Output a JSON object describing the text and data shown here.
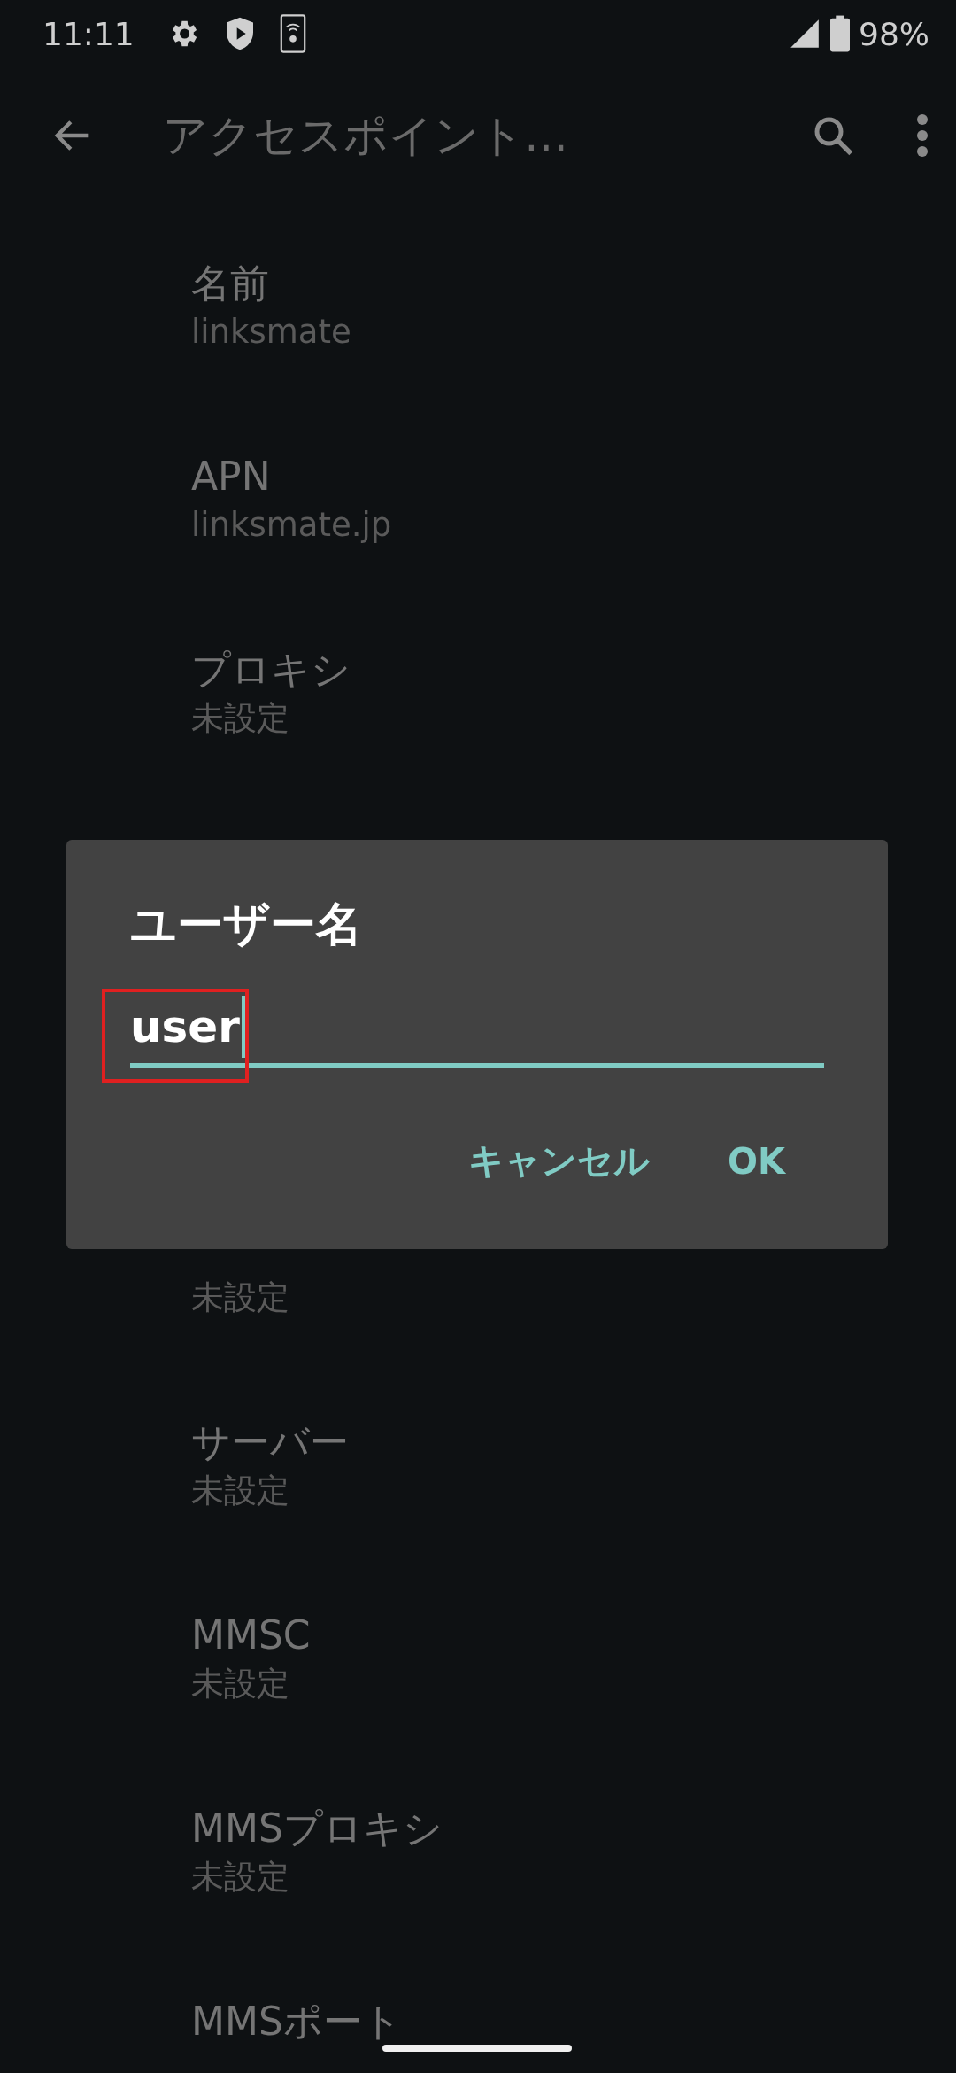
{
  "status_bar": {
    "time": "11:11",
    "battery": "98%"
  },
  "toolbar": {
    "title": "アクセスポイント…"
  },
  "settings_above": [
    {
      "title": "名前",
      "value": "linksmate"
    },
    {
      "title": "APN",
      "value": "linksmate.jp"
    },
    {
      "title": "プロキシ",
      "value": "未設定"
    }
  ],
  "settings_below": [
    {
      "value": "未設定"
    },
    {
      "title": "サーバー",
      "value": "未設定"
    },
    {
      "title": "MMSC",
      "value": "未設定"
    },
    {
      "title": "MMSプロキシ",
      "value": "未設定"
    },
    {
      "title": "MMSポート"
    }
  ],
  "dialog": {
    "title": "ユーザー名",
    "value": "user",
    "highlighted": true,
    "buttons": [
      {
        "label": "キャンセル"
      },
      {
        "label": "OK"
      }
    ]
  }
}
